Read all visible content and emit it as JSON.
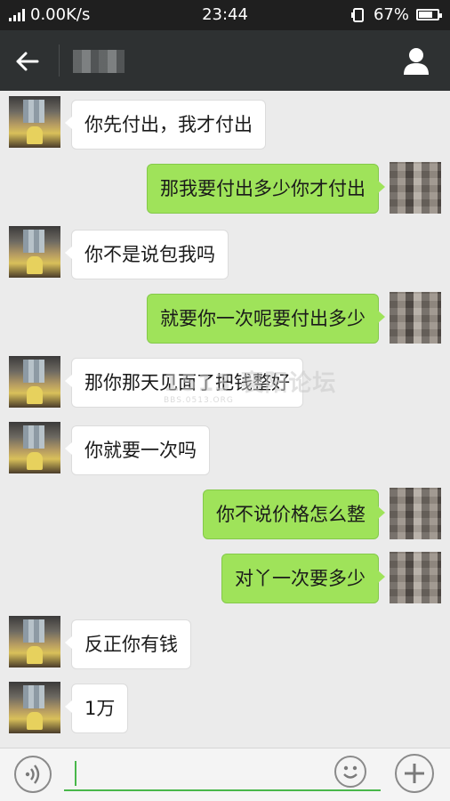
{
  "status_bar": {
    "network_speed": "0.00K/s",
    "time": "23:44",
    "battery": "67%",
    "battery_level": 0.67
  },
  "header": {
    "back_icon": "arrow-left-icon",
    "profile_icon": "person-icon"
  },
  "messages": [
    {
      "from": "her",
      "text": "你先付出，我才付出"
    },
    {
      "from": "me",
      "text": "那我要付出多少你才付出"
    },
    {
      "from": "her",
      "text": "你不是说包我吗"
    },
    {
      "from": "me",
      "text": "就要你一次呢要付出多少"
    },
    {
      "from": "her",
      "text": "那你那天见面了把钱整好"
    },
    {
      "from": "her",
      "text": "你就要一次吗"
    },
    {
      "from": "me",
      "text": "你不说价格怎么整"
    },
    {
      "from": "me",
      "text": "对丫一次要多少"
    },
    {
      "from": "her",
      "text": "反正你有钱"
    },
    {
      "from": "her",
      "text": "1万"
    }
  ],
  "watermark": {
    "main": "1513 襄阳论坛",
    "sub": "BBS.0513.ORG"
  },
  "input_bar": {
    "voice_icon": "voice-icon",
    "emoji_icon": "smiley-icon",
    "plus_icon": "plus-icon"
  },
  "colors": {
    "header_bg": "#2e3132",
    "chat_bg": "#ebebeb",
    "my_bubble": "#9fe35a",
    "her_bubble": "#ffffff",
    "accent": "#48b74a"
  }
}
